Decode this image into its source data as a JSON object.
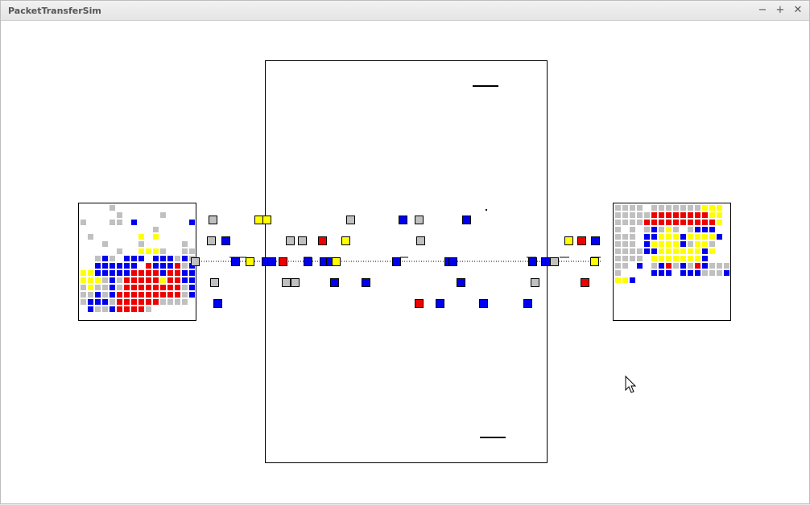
{
  "window": {
    "title": "PacketTransferSim",
    "minimize_glyph": "−",
    "maximize_glyph": "+",
    "close_glyph": "✕"
  },
  "colors": {
    "blue": "#0000ee",
    "red": "#ee0000",
    "yellow": "#ffff00",
    "gray": "#c0c0c0",
    "outline": "#000000"
  },
  "icons": [
    "window-minimize-icon",
    "window-maximize-icon",
    "window-close-icon",
    "mouse-cursor-icon"
  ]
}
